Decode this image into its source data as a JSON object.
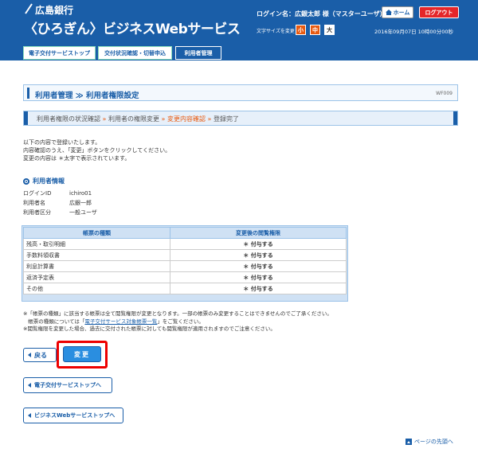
{
  "header": {
    "bank_name": "広島銀行",
    "service_name": "〈ひろぎん〉ビジネスWebサービス",
    "login_info": "ログイン名：広銀太郎 様（マスターユーザ）",
    "home_label": "ホーム",
    "logout_label": "ログアウト",
    "fontsize_label": "文字サイズを変更",
    "fontsize_small": "小",
    "fontsize_mid": "中",
    "fontsize_large": "大",
    "datetime": "2016年09月07日 10時00分00秒"
  },
  "tabs": [
    {
      "label": "電子交付サービストップ"
    },
    {
      "label": "交付状況確認・切替申込"
    },
    {
      "label": "利用者管理"
    }
  ],
  "page": {
    "title": "利用者管理 ≫ 利用者権限設定",
    "screen_id": "WF009"
  },
  "steps": {
    "s1": "利用者権限の状況確認",
    "s2": "利用者の権限変更",
    "s3": "変更内容確認",
    "s4": "登録完了",
    "sep": " » "
  },
  "instructions": [
    "以下の内容で登録いたします。",
    "内容確認のうえ、「変更」ボタンをクリックしてください。",
    "変更の内容は ＊太字で表示されています。"
  ],
  "user_info": {
    "heading": "利用者情報",
    "rows": [
      {
        "label": "ログインID",
        "value": "ichiro01"
      },
      {
        "label": "利用者名",
        "value": "広銀一郎"
      },
      {
        "label": "利用者区分",
        "value": "一般ユーザ"
      }
    ]
  },
  "table": {
    "headers": [
      "帳票の種類",
      "変更後の閲覧権限"
    ],
    "rows": [
      [
        "残高・取引明細",
        "＊ 付与する"
      ],
      [
        "手数料領収書",
        "＊ 付与する"
      ],
      [
        "利息計算書",
        "＊ 付与する"
      ],
      [
        "返済予定表",
        "＊ 付与する"
      ],
      [
        "その他",
        "＊ 付与する"
      ]
    ]
  },
  "notes": {
    "line1": "※「帳票の種類」に該当する帳票は全て閲覧権限が変更となります。一部の帳票のみ変更することはできませんのでご了承ください。",
    "line2_pre": "帳票の種類については「",
    "line2_link": "電子交付サービス対象帳票一覧",
    "line2_post": "」をご覧ください。",
    "line3": "※閲覧権限を変更した場合、過去に交付された帳票に対しても閲覧権限が適用されますのでご注意ください。"
  },
  "buttons": {
    "back": "戻る",
    "change": "変更",
    "nav_top": "電子交付サービストップへ",
    "nav_biz": "ビジネスWebサービストップへ",
    "page_top": "ページの先頭へ"
  },
  "colors": {
    "brand_blue": "#1a5ea8",
    "accent_orange": "#e85a10",
    "logout_red": "#e52629",
    "highlight_red": "#ee0000"
  }
}
